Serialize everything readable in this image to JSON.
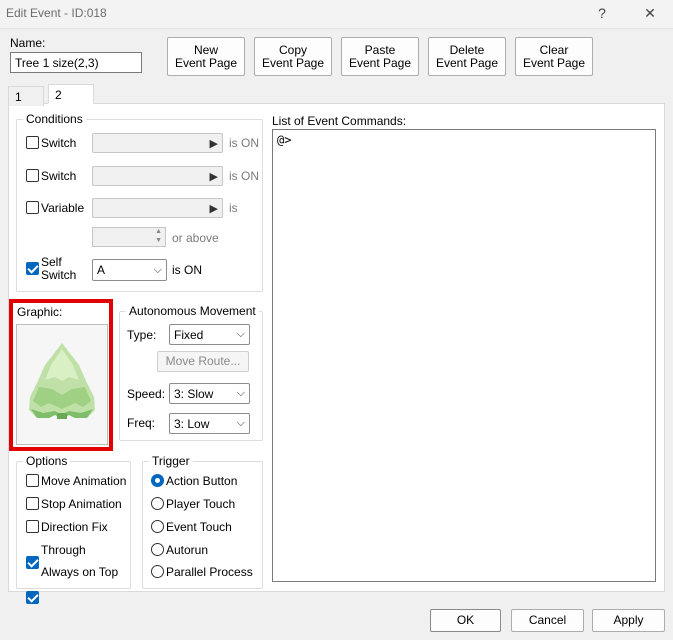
{
  "window": {
    "title": "Edit Event - ID:018",
    "help_label": "?",
    "close_label": "✕"
  },
  "name_label": "Name:",
  "name_value": "Tree 1 size(2,3)",
  "toolbar": {
    "new_page": "New\nEvent Page",
    "copy_page": "Copy\nEvent Page",
    "paste_page": "Paste\nEvent Page",
    "delete_page": "Delete\nEvent Page",
    "clear_page": "Clear\nEvent Page"
  },
  "tabs": [
    {
      "label": "1"
    },
    {
      "label": "2"
    }
  ],
  "conditions": {
    "title": "Conditions",
    "switch1": {
      "label": "Switch",
      "suffix": "is ON",
      "checked": false
    },
    "switch2": {
      "label": "Switch",
      "suffix": "is ON",
      "checked": false
    },
    "variable": {
      "label": "Variable",
      "suffix": "is",
      "checked": false
    },
    "or_above": "or above",
    "self_switch": {
      "label_line1": "Self",
      "label_line2": "Switch",
      "value": "A",
      "suffix": "is ON",
      "checked": true
    }
  },
  "graphic": {
    "label": "Graphic:"
  },
  "autonomous": {
    "title": "Autonomous Movement",
    "type_label": "Type:",
    "type_value": "Fixed",
    "move_route": "Move Route...",
    "speed_label": "Speed:",
    "speed_value": "3: Slow",
    "freq_label": "Freq:",
    "freq_value": "3: Low"
  },
  "options": {
    "title": "Options",
    "items": [
      {
        "label": "Move Animation",
        "checked": false
      },
      {
        "label": "Stop Animation",
        "checked": false
      },
      {
        "label": "Direction Fix",
        "checked": false
      },
      {
        "label": "Through",
        "checked": true
      },
      {
        "label": "Always on Top",
        "checked": true
      }
    ]
  },
  "trigger": {
    "title": "Trigger",
    "items": [
      {
        "label": "Action Button",
        "selected": true
      },
      {
        "label": "Player Touch",
        "selected": false
      },
      {
        "label": "Event Touch",
        "selected": false
      },
      {
        "label": "Autorun",
        "selected": false
      },
      {
        "label": "Parallel Process",
        "selected": false
      }
    ]
  },
  "commands": {
    "title": "List of Event Commands:",
    "lines": [
      "@>"
    ]
  },
  "footer": {
    "ok": "OK",
    "cancel": "Cancel",
    "apply": "Apply"
  },
  "colors": {
    "accent": "#0067c0",
    "highlight": "#e00000"
  }
}
